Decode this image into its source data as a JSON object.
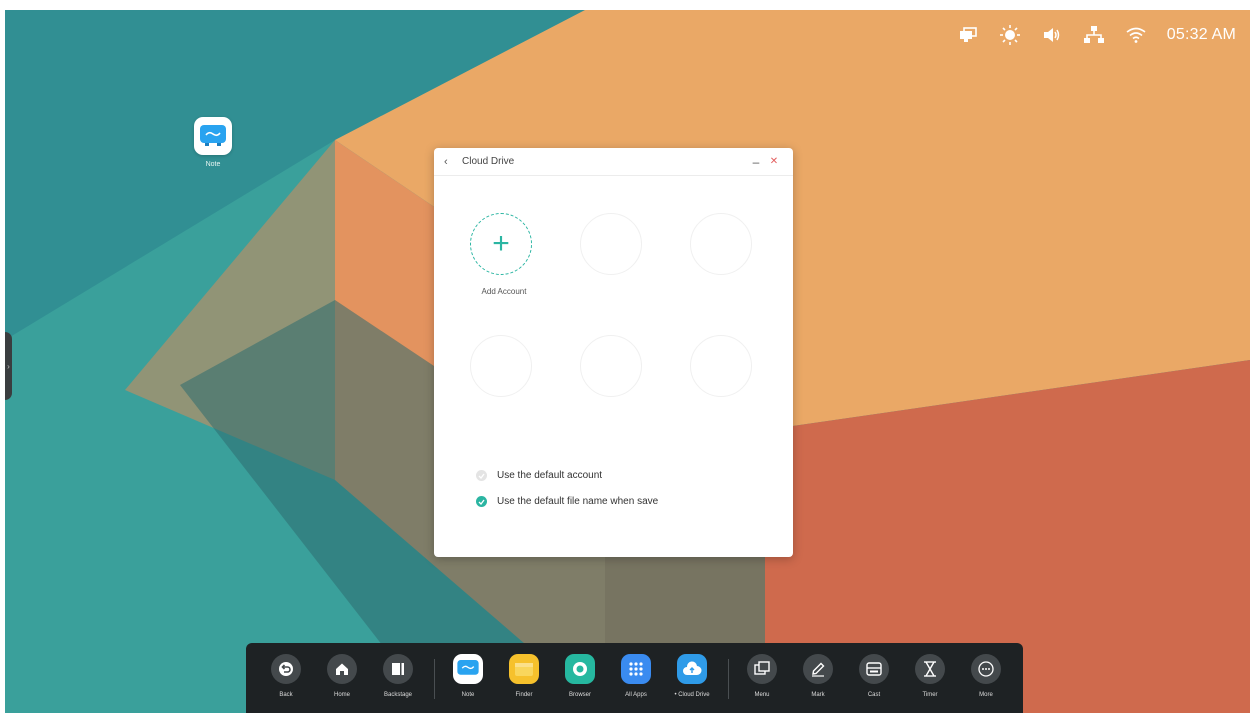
{
  "status_bar": {
    "icons": [
      "screen-mirror-icon",
      "brightness-icon",
      "volume-icon",
      "wired-network-icon",
      "wifi-icon"
    ],
    "time": "05:32 AM"
  },
  "desktop": {
    "shortcuts": [
      {
        "label": "Note",
        "icon": "note-app-icon"
      }
    ]
  },
  "side_handle": {
    "icon": "chevron-right-icon"
  },
  "window": {
    "title": "Cloud Drive",
    "back_icon": "back-chevron-icon",
    "minimize_icon": "minimize-icon",
    "close_icon": "close-icon",
    "add_account_label": "Add Account",
    "empty_slots": 5,
    "options": [
      {
        "label": "Use the default account",
        "checked": false
      },
      {
        "label": "Use the default file name when save",
        "checked": true
      }
    ],
    "accent": "#2bb5a2"
  },
  "dock": {
    "left": [
      {
        "label": "Back",
        "icon": "back-icon"
      },
      {
        "label": "Home",
        "icon": "home-icon"
      },
      {
        "label": "Backstage",
        "icon": "backstage-icon"
      }
    ],
    "apps": [
      {
        "label": "Note",
        "icon": "note-app-icon"
      },
      {
        "label": "Finder",
        "icon": "finder-app-icon"
      },
      {
        "label": "Browser",
        "icon": "browser-app-icon"
      },
      {
        "label": "All Apps",
        "icon": "all-apps-icon"
      },
      {
        "label": "• Cloud Drive",
        "icon": "cloud-drive-app-icon"
      }
    ],
    "right": [
      {
        "label": "Menu",
        "icon": "menu-icon"
      },
      {
        "label": "Mark",
        "icon": "mark-pen-icon"
      },
      {
        "label": "Cast",
        "icon": "cast-icon"
      },
      {
        "label": "Timer",
        "icon": "hourglass-icon"
      },
      {
        "label": "More",
        "icon": "more-icon"
      }
    ]
  }
}
